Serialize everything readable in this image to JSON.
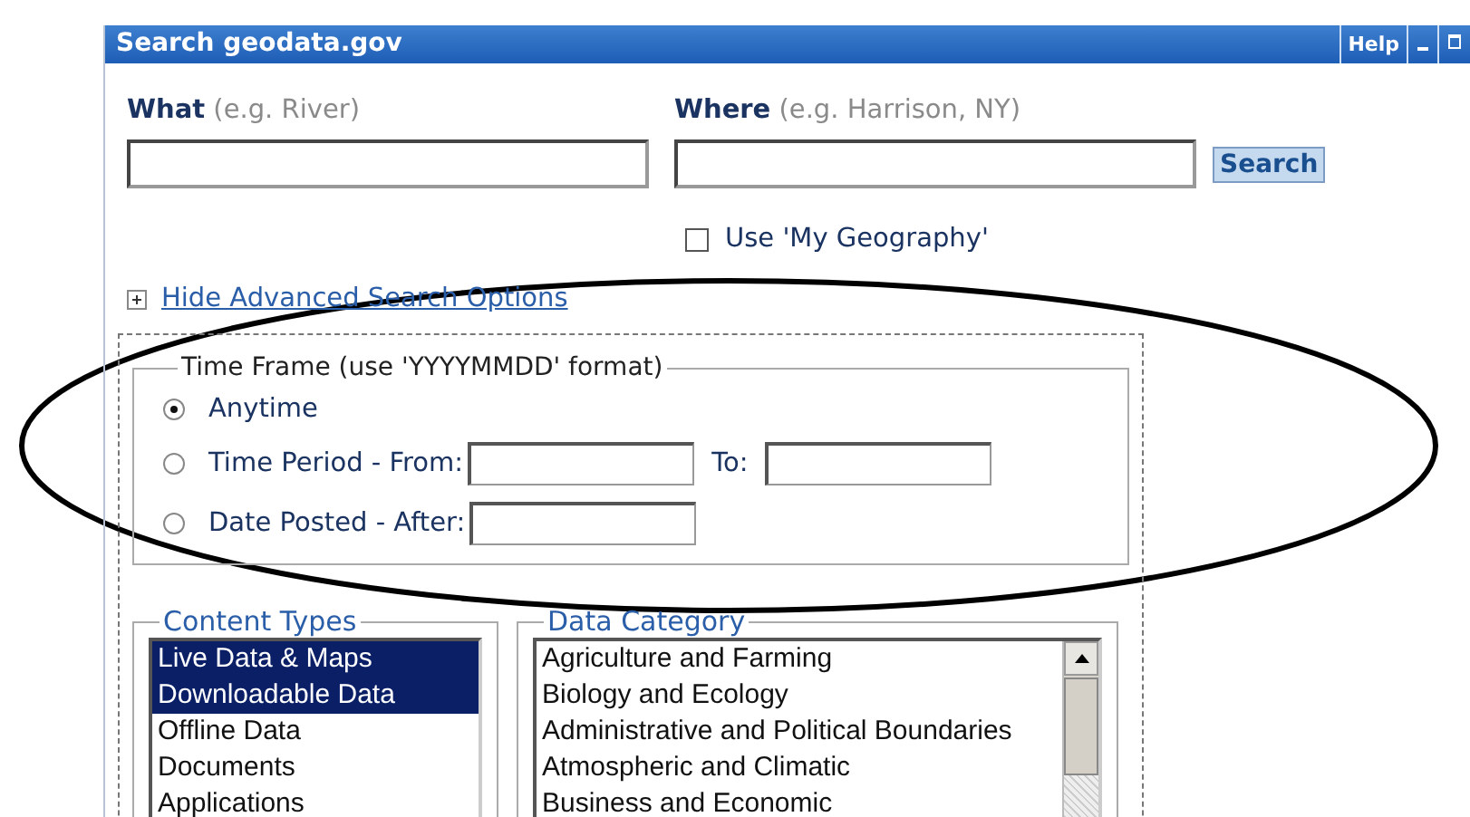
{
  "window": {
    "title": "Search geodata.gov",
    "help": "Help"
  },
  "search": {
    "what": {
      "label": "What",
      "hint": "(e.g. River)"
    },
    "where": {
      "label": "Where",
      "hint": "(e.g. Harrison, NY)"
    },
    "button": "Search",
    "my_geography": {
      "label": "Use 'My Geography'",
      "checked": false
    }
  },
  "advanced_toggle": "Hide Advanced Search Options",
  "time_frame": {
    "legend": "Time Frame (use 'YYYYMMDD' format)",
    "options": [
      {
        "kind": "plain",
        "label": "Anytime",
        "selected": true
      },
      {
        "kind": "range",
        "label": "Time Period -  From:",
        "to_label": "To:",
        "selected": false
      },
      {
        "kind": "after",
        "label": "Date Posted - After:",
        "selected": false
      }
    ]
  },
  "content_types": {
    "legend": "Content Types",
    "items": [
      {
        "label": "Live Data & Maps",
        "selected": true
      },
      {
        "label": "Downloadable Data",
        "selected": true
      },
      {
        "label": "Offline Data",
        "selected": false
      },
      {
        "label": "Documents",
        "selected": false
      },
      {
        "label": "Applications",
        "selected": false
      }
    ]
  },
  "data_category": {
    "legend": "Data Category",
    "items": [
      {
        "label": "Agriculture and Farming",
        "selected": false
      },
      {
        "label": "Biology and Ecology",
        "selected": false
      },
      {
        "label": "Administrative and Political Boundaries",
        "selected": false
      },
      {
        "label": "Atmospheric and Climatic",
        "selected": false
      },
      {
        "label": "Business and Economic",
        "selected": false
      }
    ]
  }
}
